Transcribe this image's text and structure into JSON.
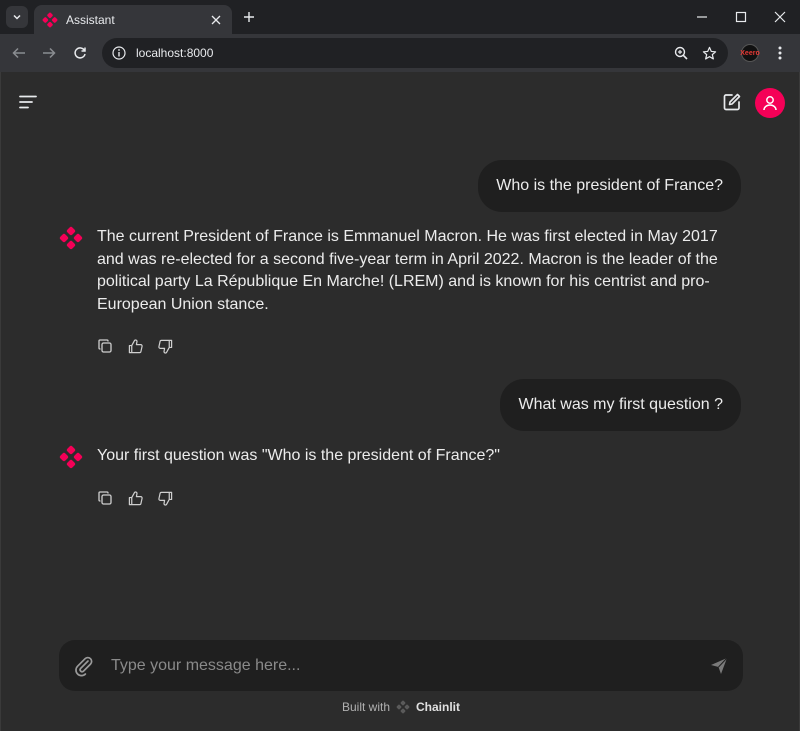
{
  "browser": {
    "tab_title": "Assistant",
    "url": "localhost:8000",
    "extension_label": "Xeero"
  },
  "app": {
    "messages": [
      {
        "role": "user",
        "text": "Who is the president of France?"
      },
      {
        "role": "assistant",
        "text": "The current President of France is Emmanuel Macron. He was first elected in May 2017 and was re-elected for a second five-year term in April 2022. Macron is the leader of the political party La République En Marche! (LREM) and is known for his centrist and pro-European Union stance."
      },
      {
        "role": "user",
        "text": "What was my first question ?"
      },
      {
        "role": "assistant",
        "text": "Your first question was \"Who is the president of France?\""
      }
    ],
    "composer": {
      "placeholder": "Type your message here..."
    },
    "footer": {
      "built_with": "Built with",
      "brand": "Chainlit"
    }
  },
  "colors": {
    "accent": "#f50057",
    "background": "#2c2c2c",
    "bubble": "#1f1f1f"
  },
  "icons": [
    "tab-search-icon",
    "chainlit-logo-icon",
    "close-icon",
    "plus-icon",
    "minimize-icon",
    "maximize-icon",
    "back-icon",
    "forward-icon",
    "reload-icon",
    "info-icon",
    "zoom-icon",
    "star-icon",
    "more-vert-icon",
    "hamburger-icon",
    "edit-icon",
    "user-icon",
    "copy-icon",
    "thumbs-up-icon",
    "thumbs-down-icon",
    "paperclip-icon",
    "send-icon"
  ]
}
